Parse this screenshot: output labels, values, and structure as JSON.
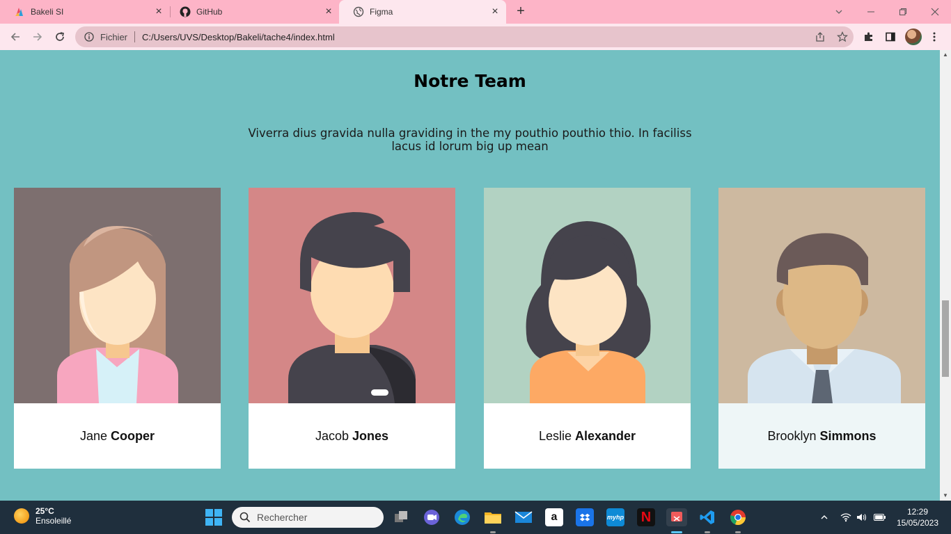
{
  "browser": {
    "tabs": [
      {
        "title": "Bakeli SI",
        "active": false
      },
      {
        "title": "GitHub",
        "active": false
      },
      {
        "title": "Figma",
        "active": true
      }
    ],
    "address": {
      "security_label": "Fichier",
      "url": "C:/Users/UVS/Desktop/Bakeli/tache4/index.html"
    }
  },
  "page": {
    "title": "Notre Team",
    "intro": "Viverra dius gravida nulla graviding in the my pouthio pouthio thio. In faciliss lacus id lorum big up mean",
    "team": [
      {
        "first": "Jane",
        "last": "Cooper",
        "bg": "#7d6f6f"
      },
      {
        "first": "Jacob",
        "last": "Jones",
        "bg": "#d48787"
      },
      {
        "first": "Leslie",
        "last": "Alexander",
        "bg": "#b2d2c2"
      },
      {
        "first": "Brooklyn",
        "last": "Simmons",
        "bg": "#cdb9a0"
      }
    ]
  },
  "taskbar": {
    "weather": {
      "temp": "25°C",
      "desc": "Ensoleillé"
    },
    "search_placeholder": "Rechercher",
    "clock": {
      "time": "12:29",
      "date": "15/05/2023"
    }
  },
  "colors": {
    "page_bg": "#73c0c2",
    "tab_strip": "#fdb4c7",
    "toolbar": "#fde7ee"
  }
}
